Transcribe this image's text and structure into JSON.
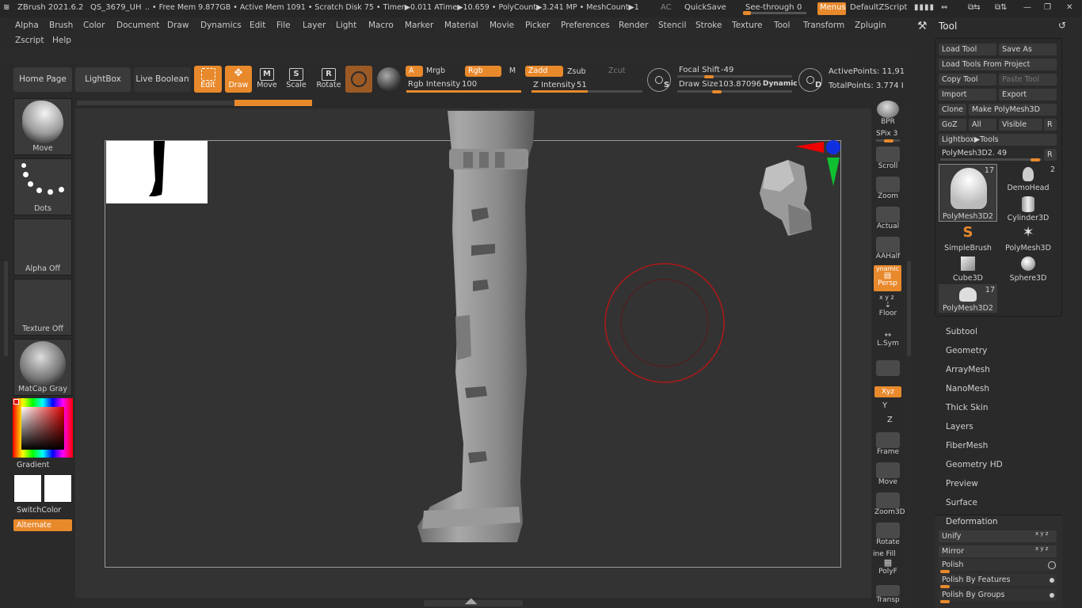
{
  "title_bar": {
    "app": "ZBrush 2021.6.2",
    "doc": "QS_3679_UH",
    "stats": "..  • Free Mem 9.877GB • Active Mem 1091 • Scratch Disk 75 •  Timer▶0.011 ATime▶10.659 • PolyCount▶3.241 MP  • MeshCount▶1",
    "ac": "AC",
    "quicksave": "QuickSave",
    "seethrough": "See-through",
    "seethrough_val": "0",
    "menus": "Menus",
    "script": "DefaultZScript"
  },
  "menu_row1": [
    "Alpha",
    "Brush",
    "Color",
    "Document",
    "Draw",
    "Dynamics",
    "Edit",
    "File",
    "Layer",
    "Light",
    "Macro",
    "Marker",
    "Material",
    "Movie",
    "Picker",
    "Preferences",
    "Render",
    "Stencil",
    "Stroke",
    "Texture",
    "Tool",
    "Transform",
    "Zplugin"
  ],
  "menu_row2": [
    "Zscript",
    "Help"
  ],
  "toolbar": {
    "home": "Home Page",
    "lightbox": "LightBox",
    "livebool": "Live Boolean",
    "edit": "Edit",
    "draw": "Draw",
    "move": "Move",
    "scale": "Scale",
    "rotate": "Rotate",
    "a": "A",
    "mrgb": "Mrgb",
    "rgb": "Rgb",
    "m": "M",
    "zadd": "Zadd",
    "zsub": "Zsub",
    "zcut": "Zcut",
    "rgb_int_label": "Rgb Intensity",
    "rgb_int": "100",
    "rgb_int_pct": 100,
    "z_int_label": "Z Intensity",
    "z_int": "51",
    "z_int_pct": 51,
    "focal_label": "Focal Shift",
    "focal": "-49",
    "drawsize_label": "Draw Size",
    "drawsize": "103.87096",
    "dynamic": "Dynamic",
    "s": "S",
    "d": "D",
    "active_points": "ActivePoints: 11,91",
    "total_points": "TotalPoints: 3.774 I"
  },
  "left": {
    "move": "Move",
    "dots": "Dots",
    "alpha": "Alpha Off",
    "texture": "Texture Off",
    "matcap": "MatCap Gray",
    "gradient": "Gradient",
    "switchcolor": "SwitchColor",
    "alternate": "Alternate"
  },
  "right_shelf": {
    "bpr": "BPR",
    "spix": "SPix 3",
    "scroll": "Scroll",
    "zoom": "Zoom",
    "actual": "Actual",
    "aahalf": "AAHalf",
    "dynamic_top": "ynamic",
    "persp": "Persp",
    "floor": "Floor",
    "xyz_small": "x y z",
    "lsym": "L.Sym",
    "xyz": "Xyz",
    "y": "Y",
    "z": "Z",
    "frame": "Frame",
    "move": "Move",
    "zoom3d": "Zoom3D",
    "rotate": "Rotate",
    "linefill": "ine Fill",
    "polyf": "PolyF",
    "transp": "Transp"
  },
  "tool_panel": {
    "title": "Tool",
    "load_tool": "Load Tool",
    "save_as": "Save As",
    "load_project": "Load Tools From Project",
    "copy_tool": "Copy Tool",
    "paste_tool": "Paste Tool",
    "import": "Import",
    "export": "Export",
    "clone": "Clone",
    "make_polymesh": "Make PolyMesh3D",
    "goz": "GoZ",
    "all": "All",
    "visible": "Visible",
    "r": "R",
    "lightbox_tools": "Lightbox▶Tools",
    "polymesh_slider": "PolyMesh3D2. 49",
    "thumbs": [
      {
        "label": "PolyMesh3D2",
        "count": "17"
      },
      {
        "label": "DemoHead",
        "count": "2"
      },
      {
        "label": "Cylinder3D",
        "count": ""
      },
      {
        "label": "SimpleBrush",
        "count": ""
      },
      {
        "label": "PolyMesh3D",
        "count": ""
      },
      {
        "label": "Cube3D",
        "count": ""
      },
      {
        "label": "Sphere3D",
        "count": ""
      },
      {
        "label": "PolyMesh3D2",
        "count": "17"
      }
    ],
    "sections": [
      "Subtool",
      "Geometry",
      "ArrayMesh",
      "NanoMesh",
      "Thick Skin",
      "Layers",
      "FiberMesh",
      "Geometry HD",
      "Preview",
      "Surface"
    ],
    "deformation": "Deformation",
    "unify": "Unify",
    "mirror": "Mirror",
    "polish": "Polish",
    "polish_features": "Polish By Features",
    "polish_groups": "Polish By Groups",
    "xyz_small": "x y z"
  },
  "colors": {
    "accent": "#e8892c",
    "bg": "#2b2b2b",
    "canvas": "#333333"
  }
}
